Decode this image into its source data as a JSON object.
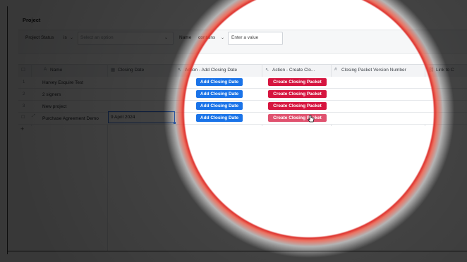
{
  "page": {
    "title": "Project"
  },
  "filters": {
    "field1_label": "Project Status",
    "field1_operator": "is",
    "field1_placeholder": "Select an option",
    "field2_label": "Name",
    "field2_operator": "contains",
    "field2_placeholder": "Enter a value"
  },
  "columns": [
    {
      "label": "Name",
      "icon": "text-icon"
    },
    {
      "label": "Closing Date",
      "icon": "calendar-icon"
    },
    {
      "label": "Action - Add Closing Date",
      "icon": "cursor-click-icon"
    },
    {
      "label": "Action - Create Clo...",
      "icon": "cursor-click-icon"
    },
    {
      "label": "Closing Packet Version Number",
      "icon": "hash-icon"
    },
    {
      "label": "Link to C",
      "icon": "link-icon"
    }
  ],
  "rows": [
    {
      "num": "1",
      "name": "Harvey Esquire Test",
      "closing_date": "",
      "add_btn": "Add Closing Date",
      "create_btn": "Create Closing Packet"
    },
    {
      "num": "2",
      "name": "2 signers",
      "closing_date": "",
      "add_btn": "Add Closing Date",
      "create_btn": "Create Closing Packet"
    },
    {
      "num": "3",
      "name": "New project",
      "closing_date": "",
      "add_btn": "Add Closing Date",
      "create_btn": "Create Closing Packet"
    },
    {
      "num": "",
      "name": "Purchase Agreement Demo",
      "closing_date": "9 April 2024",
      "add_btn": "Add Closing Date",
      "create_btn": "Create Closing Packet"
    }
  ],
  "add_row_symbol": "+",
  "colors": {
    "primary": "#1a73e8",
    "danger": "#d6153f",
    "selection": "#2b6ee6",
    "spotlight_ring": "#dc2823"
  }
}
